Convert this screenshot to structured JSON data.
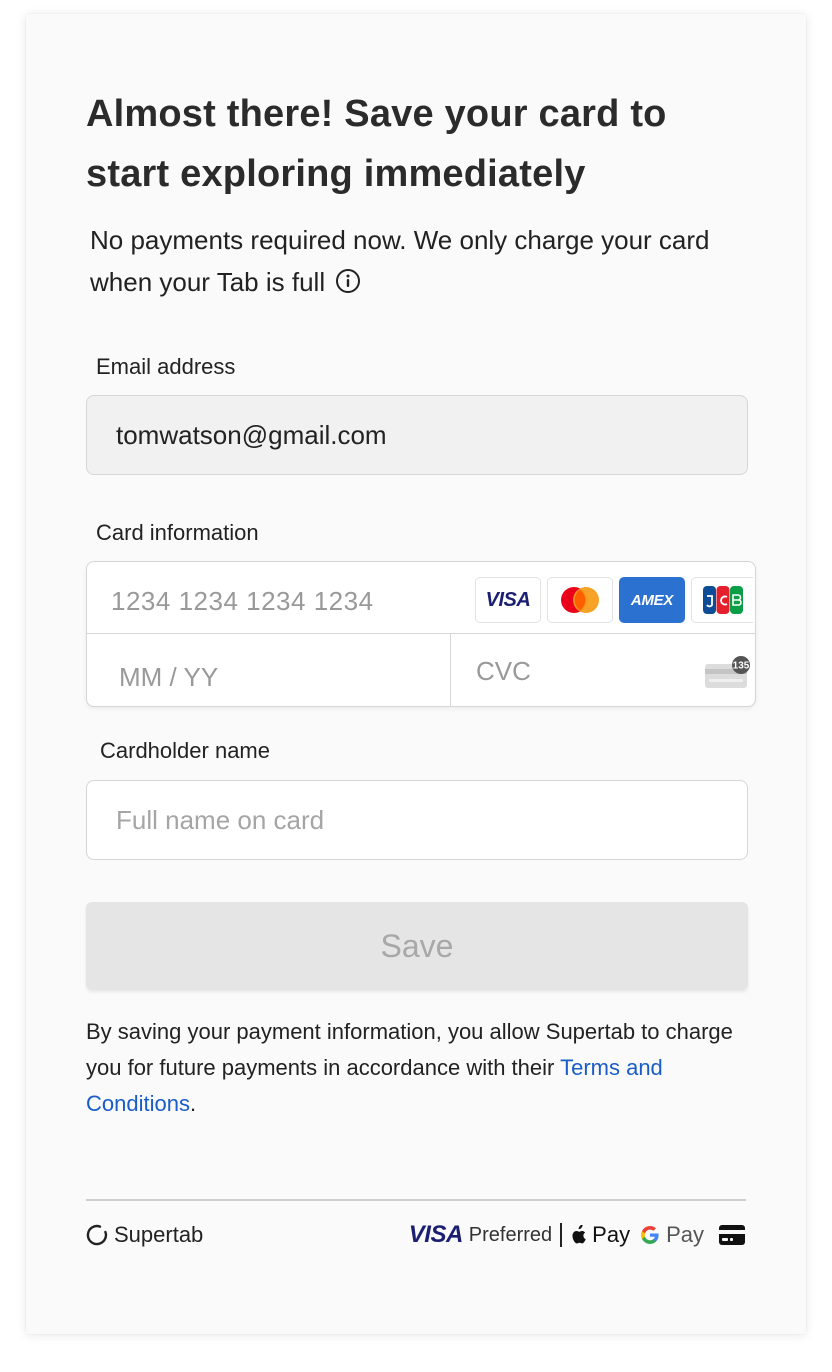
{
  "header": {
    "title": "Almost there! Save your card to start exploring immediately",
    "subtitle": "No payments required now. We only charge your card when your Tab is full"
  },
  "icons": {
    "info": "info-circle-icon",
    "visa": "visa-card-icon",
    "mastercard": "mastercard-icon",
    "amex": "amex-card-icon",
    "jcb": "jcb-card-icon",
    "cvc": "cvc-card-icon",
    "supertab_logo": "supertab-logo-icon",
    "apple": "apple-icon",
    "google": "google-g-icon",
    "card": "credit-card-icon"
  },
  "form": {
    "email_label": "Email address",
    "email_value": "tomwatson@gmail.com",
    "card_label": "Card information",
    "card_number_placeholder": "1234 1234 1234 1234",
    "expiry_placeholder": "MM / YY",
    "cvc_placeholder": "CVC",
    "cvc_badge": "135",
    "amex_mark": "AMEX",
    "name_label": "Cardholder name",
    "name_placeholder": "Full name on card",
    "save_label": "Save"
  },
  "legal": {
    "text": "By saving your payment information, you allow Supertab to charge you for future payments in accordance with their ",
    "link": "Terms and Conditions",
    "end": "."
  },
  "footer": {
    "brand": "Supertab",
    "visa": "VISA",
    "visa_preferred": "Preferred",
    "apple_pay": "Pay",
    "google_pay": "Pay"
  },
  "colors": {
    "link": "#1a5cc8",
    "visa_blue": "#1a1f71",
    "amex_blue": "#2a71d0",
    "mastercard_red": "#eb001b",
    "mastercard_yellow": "#f79e1b",
    "save_disabled_bg": "#e5e5e5"
  }
}
